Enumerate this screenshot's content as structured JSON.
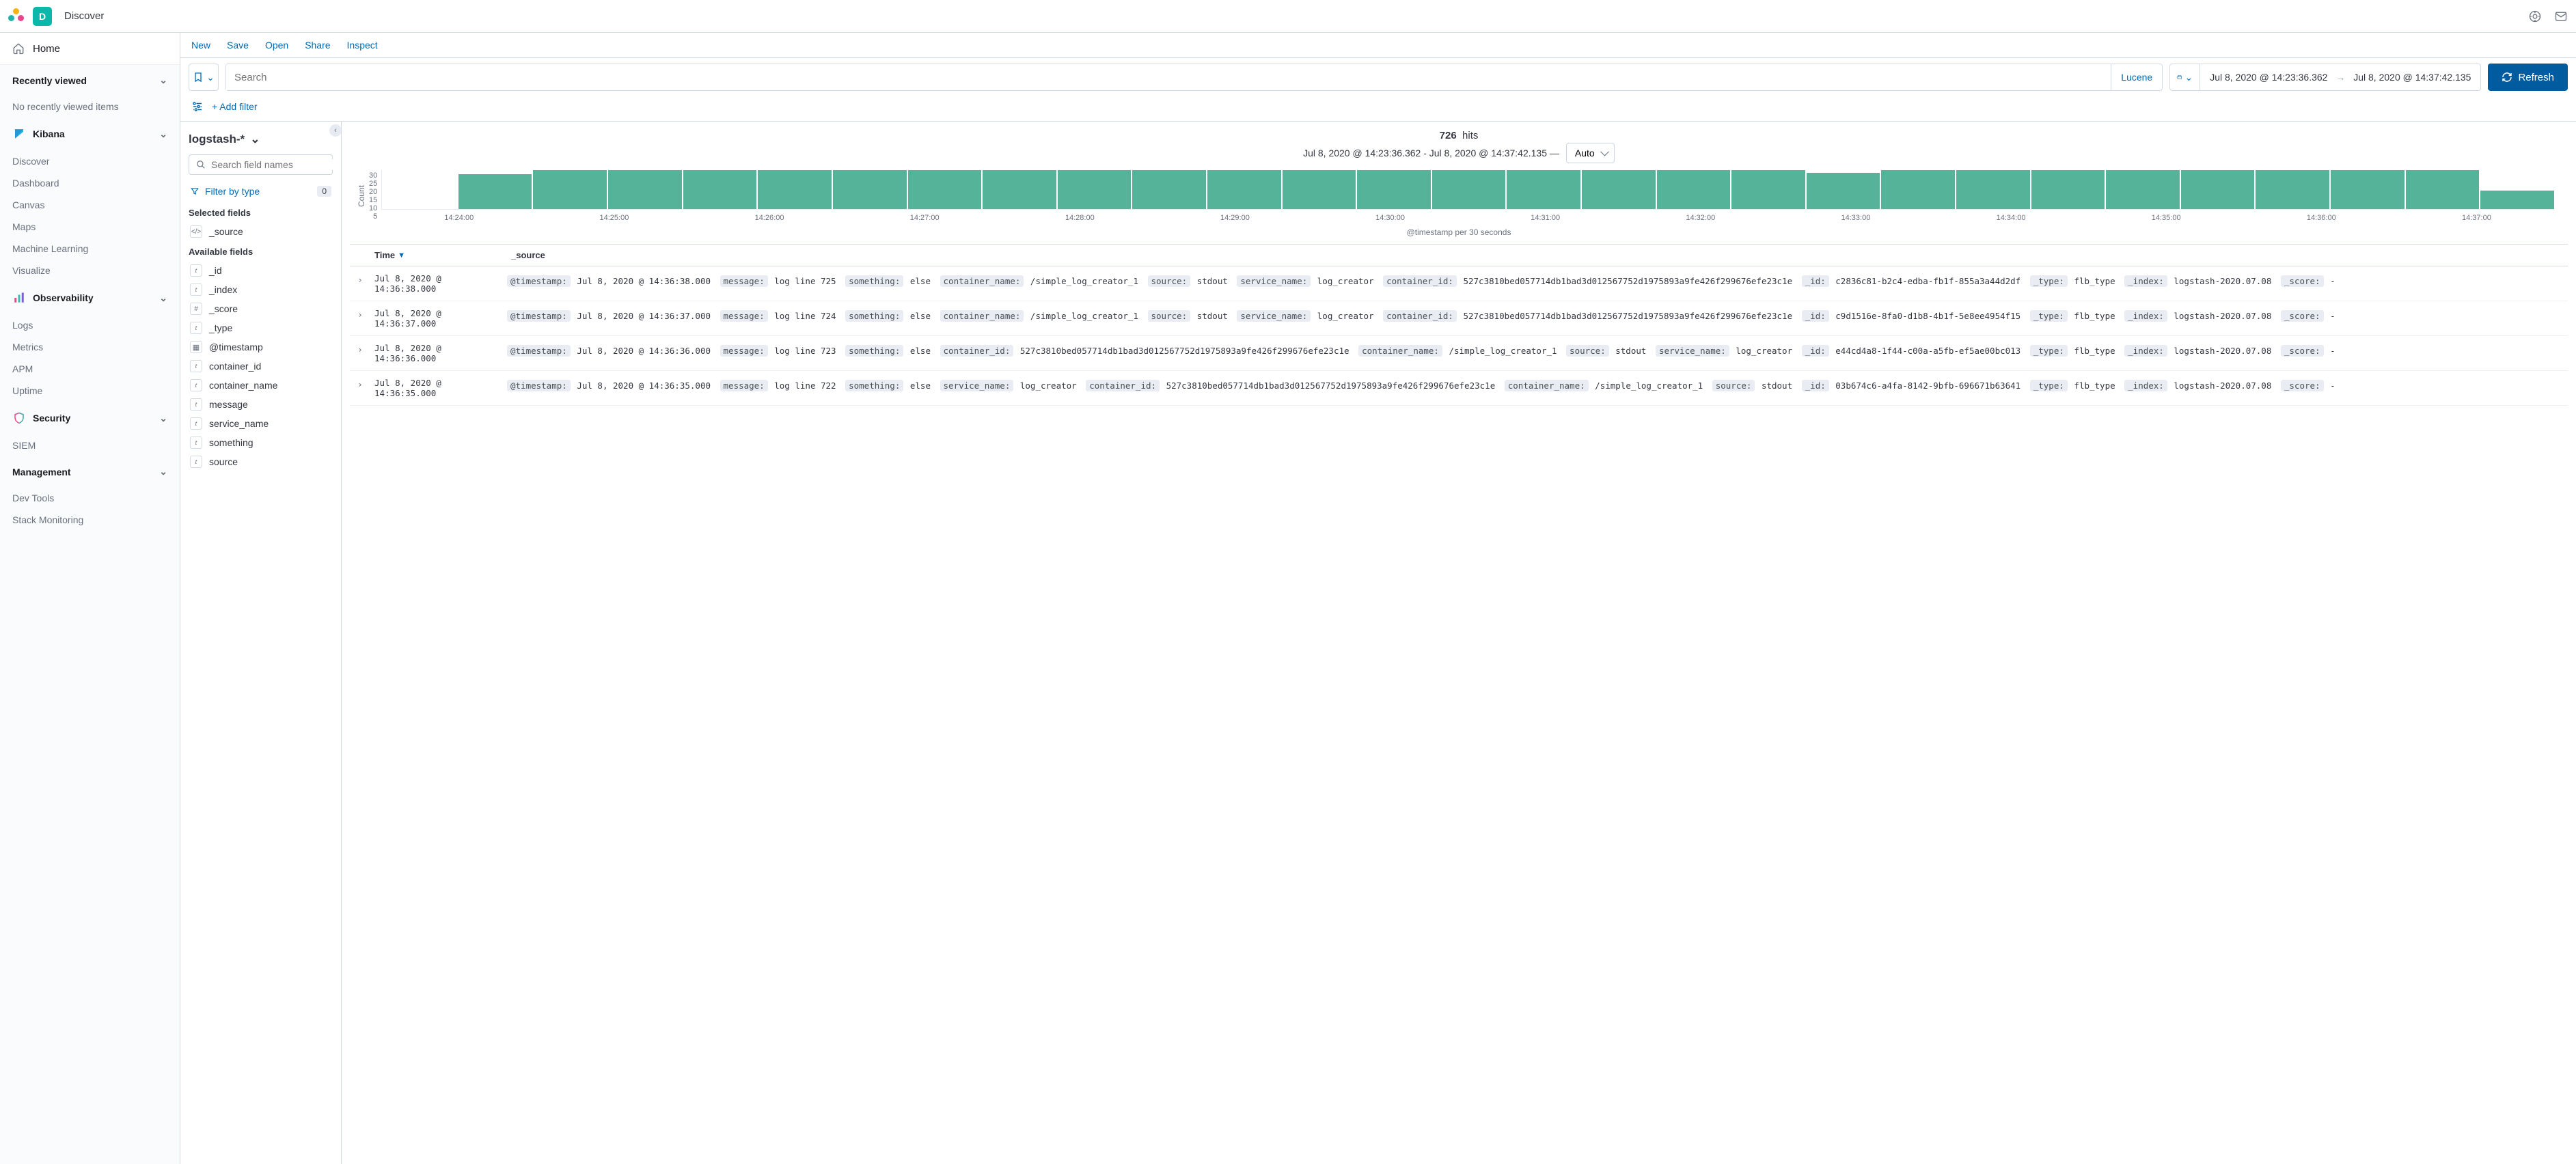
{
  "topbar": {
    "app_badge_letter": "D",
    "title": "Discover"
  },
  "nav": {
    "home": "Home",
    "recently_viewed": {
      "label": "Recently viewed",
      "empty": "No recently viewed items"
    },
    "kibana": {
      "label": "Kibana",
      "items": [
        "Discover",
        "Dashboard",
        "Canvas",
        "Maps",
        "Machine Learning",
        "Visualize"
      ]
    },
    "observability": {
      "label": "Observability",
      "items": [
        "Logs",
        "Metrics",
        "APM",
        "Uptime"
      ]
    },
    "security": {
      "label": "Security",
      "items": [
        "SIEM"
      ]
    },
    "management": {
      "label": "Management",
      "items": [
        "Dev Tools",
        "Stack Monitoring"
      ]
    }
  },
  "menubar": {
    "new": "New",
    "save": "Save",
    "open": "Open",
    "share": "Share",
    "inspect": "Inspect"
  },
  "querybar": {
    "search_placeholder": "Search",
    "language": "Lucene",
    "date_from": "Jul 8, 2020 @ 14:23:36.362",
    "date_to": "Jul 8, 2020 @ 14:37:42.135",
    "refresh": "Refresh"
  },
  "filterbar": {
    "add_filter": "+ Add filter"
  },
  "fields": {
    "index_pattern": "logstash-*",
    "search_placeholder": "Search field names",
    "filter_by_type": "Filter by type",
    "filter_count": "0",
    "selected_heading": "Selected fields",
    "selected": [
      {
        "icon": "src",
        "name": "_source"
      }
    ],
    "available_heading": "Available fields",
    "available": [
      {
        "icon": "t",
        "name": "_id"
      },
      {
        "icon": "t",
        "name": "_index"
      },
      {
        "icon": "hash",
        "name": "_score"
      },
      {
        "icon": "t",
        "name": "_type"
      },
      {
        "icon": "cal",
        "name": "@timestamp"
      },
      {
        "icon": "t",
        "name": "container_id"
      },
      {
        "icon": "t",
        "name": "container_name"
      },
      {
        "icon": "t",
        "name": "message"
      },
      {
        "icon": "t",
        "name": "service_name"
      },
      {
        "icon": "t",
        "name": "something"
      },
      {
        "icon": "t",
        "name": "source"
      }
    ]
  },
  "results": {
    "hits_count": "726",
    "hits_label": "hits",
    "subtitle": "Jul 8, 2020 @ 14:23:36.362 - Jul 8, 2020 @ 14:37:42.135 —",
    "interval": "Auto",
    "xaxis_label": "@timestamp per 30 seconds",
    "col_time": "Time",
    "col_source": "_source"
  },
  "chart_data": {
    "type": "bar",
    "ylabel": "Count",
    "ylim": [
      0,
      30
    ],
    "yticks": [
      30,
      25,
      20,
      15,
      10,
      5
    ],
    "xticks": [
      "14:24:00",
      "14:25:00",
      "14:26:00",
      "14:27:00",
      "14:28:00",
      "14:29:00",
      "14:30:00",
      "14:31:00",
      "14:32:00",
      "14:33:00",
      "14:34:00",
      "14:35:00",
      "14:36:00",
      "14:37:00"
    ],
    "values": [
      0,
      27,
      30,
      30,
      30,
      30,
      30,
      30,
      30,
      30,
      30,
      30,
      30,
      30,
      30,
      30,
      30,
      30,
      30,
      28,
      30,
      30,
      30,
      30,
      30,
      30,
      30,
      30,
      14
    ]
  },
  "rows": [
    {
      "time": "Jul 8, 2020 @ 14:36:38.000",
      "kv": [
        [
          "@timestamp:",
          "Jul 8, 2020 @ 14:36:38.000"
        ],
        [
          "message:",
          "log line 725"
        ],
        [
          "something:",
          "else"
        ],
        [
          "container_name:",
          "/simple_log_creator_1"
        ],
        [
          "source:",
          "stdout"
        ],
        [
          "service_name:",
          "log_creator"
        ],
        [
          "container_id:",
          "527c3810bed057714db1bad3d012567752d1975893a9fe426f299676efe23c1e"
        ],
        [
          "_id:",
          "c2836c81-b2c4-edba-fb1f-855a3a44d2df"
        ],
        [
          "_type:",
          "flb_type"
        ],
        [
          "_index:",
          "logstash-2020.07.08"
        ],
        [
          "_score:",
          " - "
        ]
      ]
    },
    {
      "time": "Jul 8, 2020 @ 14:36:37.000",
      "kv": [
        [
          "@timestamp:",
          "Jul 8, 2020 @ 14:36:37.000"
        ],
        [
          "message:",
          "log line 724"
        ],
        [
          "something:",
          "else"
        ],
        [
          "container_name:",
          "/simple_log_creator_1"
        ],
        [
          "source:",
          "stdout"
        ],
        [
          "service_name:",
          "log_creator"
        ],
        [
          "container_id:",
          "527c3810bed057714db1bad3d012567752d1975893a9fe426f299676efe23c1e"
        ],
        [
          "_id:",
          "c9d1516e-8fa0-d1b8-4b1f-5e8ee4954f15"
        ],
        [
          "_type:",
          "flb_type"
        ],
        [
          "_index:",
          "logstash-2020.07.08"
        ],
        [
          "_score:",
          " - "
        ]
      ]
    },
    {
      "time": "Jul 8, 2020 @ 14:36:36.000",
      "kv": [
        [
          "@timestamp:",
          "Jul 8, 2020 @ 14:36:36.000"
        ],
        [
          "message:",
          "log line 723"
        ],
        [
          "something:",
          "else"
        ],
        [
          "container_id:",
          "527c3810bed057714db1bad3d012567752d1975893a9fe426f299676efe23c1e"
        ],
        [
          "container_name:",
          "/simple_log_creator_1"
        ],
        [
          "source:",
          "stdout"
        ],
        [
          "service_name:",
          "log_creator"
        ],
        [
          "_id:",
          "e44cd4a8-1f44-c00a-a5fb-ef5ae00bc013"
        ],
        [
          "_type:",
          "flb_type"
        ],
        [
          "_index:",
          "logstash-2020.07.08"
        ],
        [
          "_score:",
          " - "
        ]
      ]
    },
    {
      "time": "Jul 8, 2020 @ 14:36:35.000",
      "kv": [
        [
          "@timestamp:",
          "Jul 8, 2020 @ 14:36:35.000"
        ],
        [
          "message:",
          "log line 722"
        ],
        [
          "something:",
          "else"
        ],
        [
          "service_name:",
          "log_creator"
        ],
        [
          "container_id:",
          "527c3810bed057714db1bad3d012567752d1975893a9fe426f299676efe23c1e"
        ],
        [
          "container_name:",
          "/simple_log_creator_1"
        ],
        [
          "source:",
          "stdout"
        ],
        [
          "_id:",
          "03b674c6-a4fa-8142-9bfb-696671b63641"
        ],
        [
          "_type:",
          "flb_type"
        ],
        [
          "_index:",
          "logstash-2020.07.08"
        ],
        [
          "_score:",
          " - "
        ]
      ]
    }
  ]
}
